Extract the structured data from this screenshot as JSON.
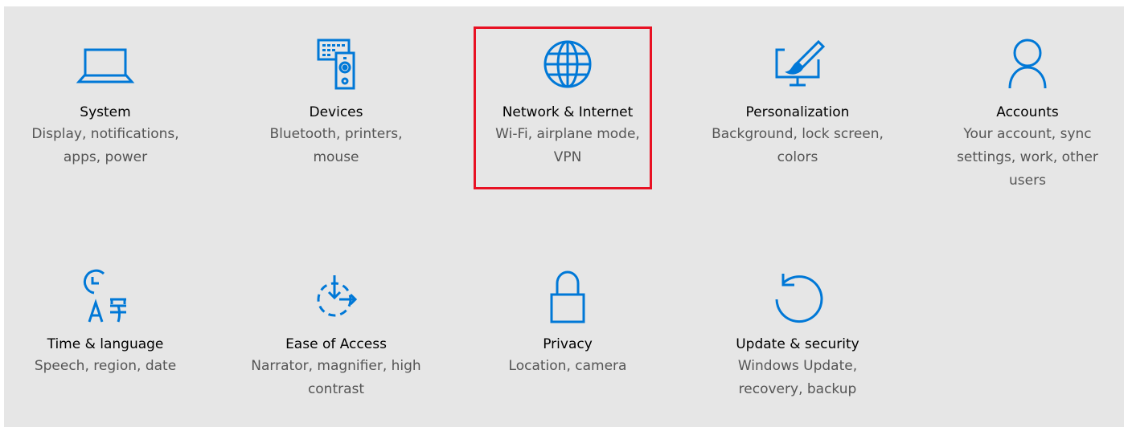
{
  "colors": {
    "accent": "#0078d7",
    "background": "#e6e6e6",
    "highlight": "#e81123",
    "title_text": "#000000",
    "desc_text": "#555555"
  },
  "categories": [
    {
      "title": "System",
      "description": "Display, notifications, apps, power",
      "icon": "laptop-icon"
    },
    {
      "title": "Devices",
      "description": "Bluetooth, printers, mouse",
      "icon": "keyboard-speaker-icon"
    },
    {
      "title": "Network & Internet",
      "description": "Wi-Fi, airplane mode, VPN",
      "icon": "globe-icon"
    },
    {
      "title": "Personalization",
      "description": "Background, lock screen, colors",
      "icon": "paintbrush-monitor-icon"
    },
    {
      "title": "Accounts",
      "description": "Your account, sync settings, work, other users",
      "icon": "person-icon"
    },
    {
      "title": "Time & language",
      "description": "Speech, region, date",
      "icon": "clock-language-icon"
    },
    {
      "title": "Ease of Access",
      "description": "Narrator, magnifier, high contrast",
      "icon": "ease-of-access-icon"
    },
    {
      "title": "Privacy",
      "description": "Location, camera",
      "icon": "padlock-icon"
    },
    {
      "title": "Update & security",
      "description": "Windows Update, recovery, backup",
      "icon": "refresh-icon"
    }
  ]
}
